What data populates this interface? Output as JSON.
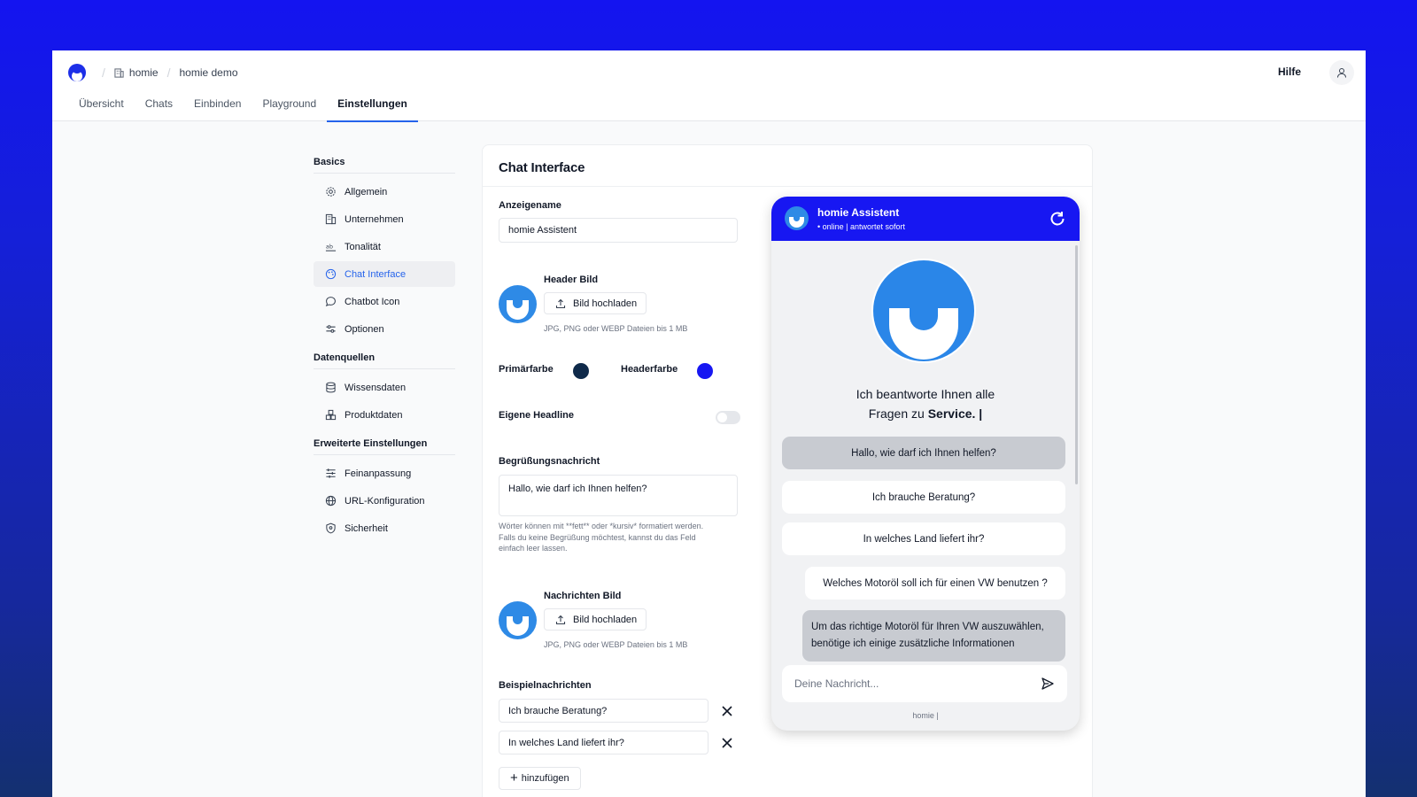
{
  "breadcrumb": {
    "org": "homie",
    "project": "homie demo"
  },
  "header": {
    "help": "Hilfe"
  },
  "tabs": [
    "Übersicht",
    "Chats",
    "Einbinden",
    "Playground",
    "Einstellungen"
  ],
  "sidebar": {
    "basics": "Basics",
    "basics_items": [
      "Allgemein",
      "Unternehmen",
      "Tonalität",
      "Chat Interface",
      "Chatbot Icon",
      "Optionen"
    ],
    "data": "Datenquellen",
    "data_items": [
      "Wissensdaten",
      "Produktdaten"
    ],
    "advanced": "Erweiterte Einstellungen",
    "advanced_items": [
      "Feinanpassung",
      "URL-Konfiguration",
      "Sicherheit"
    ]
  },
  "panel": {
    "title": "Chat Interface",
    "display_name_label": "Anzeigename",
    "display_name_value": "homie Assistent",
    "header_image_label": "Header Bild",
    "upload_label": "Bild hochladen",
    "upload_hint": "JPG, PNG oder WEBP Dateien bis 1 MB",
    "primary_color_label": "Primärfarbe",
    "header_color_label": "Headerfarbe",
    "primary_color": "#0f2a4a",
    "header_color": "#1717f2",
    "own_headline_label": "Eigene Headline",
    "greeting_label": "Begrüßungsnachricht",
    "greeting_value": "Hallo, wie darf ich Ihnen helfen?",
    "greeting_hint_1": "Wörter können mit **fett** oder *kursiv* formatiert werden.",
    "greeting_hint_2": "Falls du keine Begrüßung möchtest, kannst du das Feld",
    "greeting_hint_3": "einfach leer lassen.",
    "message_image_label": "Nachrichten Bild",
    "examples_label": "Beispielnachrichten",
    "examples": [
      "Ich brauche Beratung?",
      "In welches Land liefert ihr?"
    ],
    "add_label": "hinzufügen"
  },
  "chat": {
    "name": "homie Assistent",
    "status": "• online | antwortet sofort",
    "intro_line1": "Ich beantworte Ihnen alle",
    "intro_line2_pre": "Fragen zu ",
    "intro_line2_bold": "Service. |",
    "greeting": "Hallo, wie darf ich Ihnen helfen?",
    "suggestions": [
      "Ich brauche Beratung?",
      "In welches Land liefert ihr?"
    ],
    "user_message": "Welches Motoröl soll ich für einen VW benutzen ?",
    "bot_reply": "Um das richtige Motoröl für Ihren VW auszuwählen, benötige ich einige zusätzliche Informationen",
    "input_placeholder": "Deine Nachricht...",
    "footer": "homie |"
  }
}
